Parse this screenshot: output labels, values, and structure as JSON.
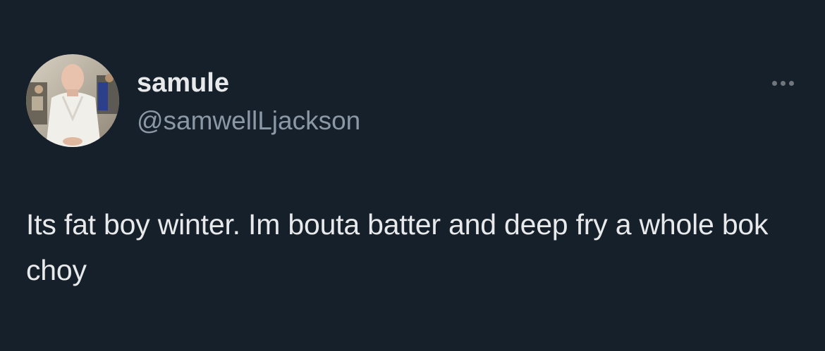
{
  "author": {
    "display_name": "samule",
    "handle": "@samwellLjackson",
    "avatar_icon": "avatar-photo-chef-in-white-coat"
  },
  "menu": {
    "icon": "more-options-icon"
  },
  "tweet": {
    "text": "Its fat boy winter. Im bouta batter and deep fry a whole bok choy"
  },
  "colors": {
    "background": "#16202b",
    "primary_text": "#e7e9ea",
    "secondary_text": "#8b98a5"
  }
}
